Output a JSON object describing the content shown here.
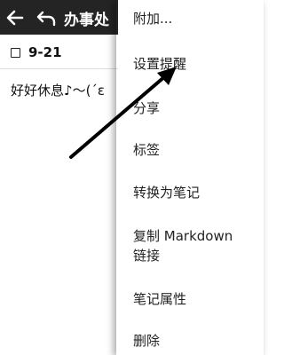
{
  "appbar": {
    "title": "办事处",
    "back_icon": "arrow-left-icon",
    "undo_icon": "undo-icon"
  },
  "note": {
    "checklist_item": "9-21",
    "body_text": "好好休息♪～(´ε"
  },
  "menu": {
    "items": [
      {
        "label": "附加..."
      },
      {
        "label": "设置提醒"
      },
      {
        "label": "分享"
      },
      {
        "label": "标签"
      },
      {
        "label": "转换为笔记"
      },
      {
        "label_line1": "复制 Markdown",
        "label_line2": "链接"
      },
      {
        "label": "笔记属性"
      },
      {
        "label": "删除"
      }
    ]
  },
  "colors": {
    "appbar_bg": "#242424",
    "menu_bg": "#ffffff",
    "annotation_arrow": "#000000"
  }
}
